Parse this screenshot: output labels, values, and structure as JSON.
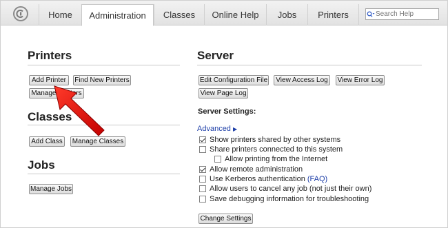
{
  "nav": {
    "tabs": [
      "Home",
      "Administration",
      "Classes",
      "Online Help",
      "Jobs",
      "Printers"
    ],
    "active_tab": "Administration",
    "search_placeholder": "Search Help"
  },
  "printers": {
    "heading": "Printers",
    "add_printer": "Add Printer",
    "find_new_printers": "Find New Printers",
    "manage_printers": "Manage Printers"
  },
  "classes": {
    "heading": "Classes",
    "add_class": "Add Class",
    "manage_classes": "Manage Classes"
  },
  "jobs": {
    "heading": "Jobs",
    "manage_jobs": "Manage Jobs"
  },
  "server": {
    "heading": "Server",
    "edit_config": "Edit Configuration File",
    "view_access_log": "View Access Log",
    "view_error_log": "View Error Log",
    "view_page_log": "View Page Log",
    "settings_title": "Server Settings:",
    "advanced": "Advanced",
    "options": [
      {
        "label": "Show printers shared by other systems",
        "checked": true
      },
      {
        "label": "Share printers connected to this system",
        "checked": false
      },
      {
        "label": "Allow printing from the Internet",
        "checked": false
      },
      {
        "label": "Allow remote administration",
        "checked": true
      },
      {
        "label": "Use Kerberos authentication",
        "checked": false
      },
      {
        "label": "Allow users to cancel any job (not just their own)",
        "checked": false
      },
      {
        "label": "Save debugging information for troubleshooting",
        "checked": false
      }
    ],
    "faq": "(FAQ)",
    "change_settings": "Change Settings"
  },
  "colors": {
    "link": "#1e3fa8",
    "arrow": "#e01010"
  }
}
